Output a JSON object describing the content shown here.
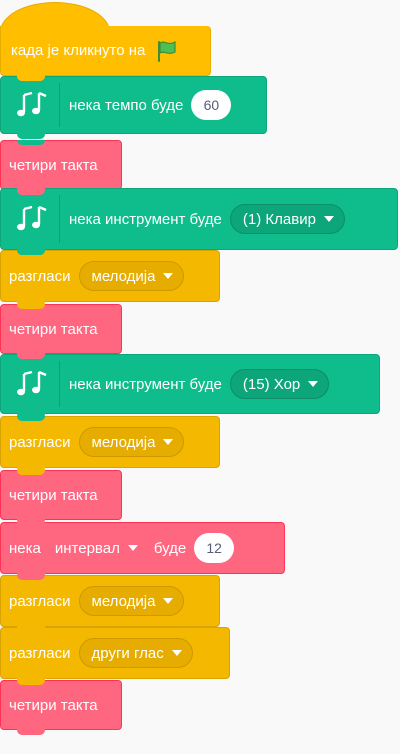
{
  "script": {
    "hat": {
      "label": "када је кликнуто на",
      "icon": "green-flag-icon"
    },
    "set_tempo": {
      "label": "нека темпо буде",
      "value": "60",
      "icon": "music-notes-icon"
    },
    "four_bars_1": {
      "label": "четири такта"
    },
    "set_instrument_1": {
      "label": "нека инструмент буде",
      "value": "(1) Клавир",
      "icon": "music-notes-icon"
    },
    "play_1": {
      "label": "разгласи",
      "value": "мелодија"
    },
    "four_bars_2": {
      "label": "четири такта"
    },
    "set_instrument_2": {
      "label": "нека инструмент буде",
      "value": "(15) Хор",
      "icon": "music-notes-icon"
    },
    "play_2": {
      "label": "разгласи",
      "value": "мелодија"
    },
    "four_bars_3": {
      "label": "четири такта"
    },
    "set_var": {
      "label_prefix": "нека",
      "variable": "интервал",
      "label_suffix": "буде",
      "value": "12"
    },
    "play_3": {
      "label": "разгласи",
      "value": "мелодија"
    },
    "play_4": {
      "label": "разгласи",
      "value": "други глас"
    },
    "four_bars_4": {
      "label": "четири такта"
    }
  },
  "colors": {
    "events": "#ffbf00",
    "music": "#0fbd8c",
    "custom": "#ff6680",
    "looks": "#f5b800",
    "variables": "#ff8c1a",
    "workspace": "#f9f9f9"
  }
}
